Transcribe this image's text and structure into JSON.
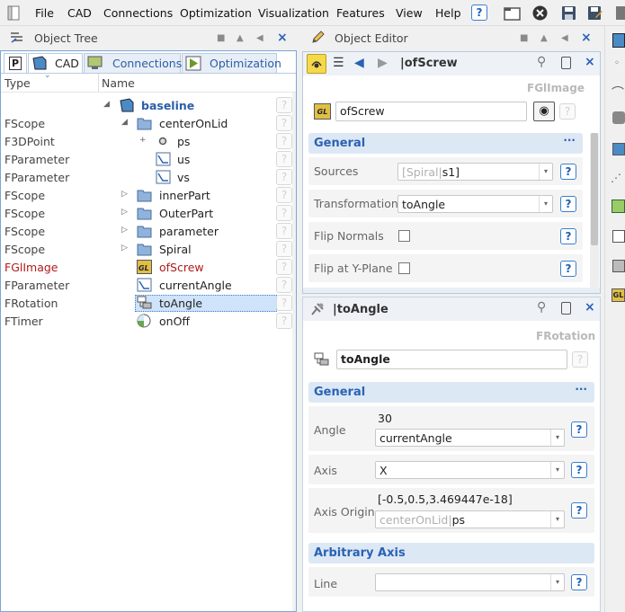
{
  "menubar": {
    "items": [
      "File",
      "CAD",
      "Connections",
      "Optimization",
      "Visualization",
      "Features",
      "View",
      "Help"
    ],
    "help_button": "?"
  },
  "object_tree": {
    "title": "Object Tree",
    "tabs": [
      {
        "label": "P"
      },
      {
        "label": "CAD"
      },
      {
        "label": "Connections"
      },
      {
        "label": "Optimization"
      }
    ],
    "columns": {
      "type": "Type",
      "name": "Name"
    },
    "root": "baseline",
    "rows": [
      {
        "type": "FScope",
        "name": "centerOnLid",
        "expander": "◢",
        "icon": "folder-icon"
      },
      {
        "type": "F3DPoint",
        "name": "ps",
        "expander": "+",
        "icon": "point-icon"
      },
      {
        "type": "FParameter",
        "name": "us",
        "icon": "parameter-icon"
      },
      {
        "type": "FParameter",
        "name": "vs",
        "icon": "parameter-icon"
      },
      {
        "type": "FScope",
        "name": "innerPart",
        "expander": "▷",
        "icon": "folder-icon"
      },
      {
        "type": "FScope",
        "name": "OuterPart",
        "expander": "▷",
        "icon": "folder-icon"
      },
      {
        "type": "FScope",
        "name": "parameter",
        "expander": "▷",
        "icon": "folder-icon"
      },
      {
        "type": "FScope",
        "name": "Spiral",
        "expander": "▷",
        "icon": "folder-icon"
      },
      {
        "type": "FGlImage",
        "name": "ofScrew",
        "icon": "gl-image-icon",
        "red": true
      },
      {
        "type": "FParameter",
        "name": "currentAngle",
        "icon": "parameter-icon"
      },
      {
        "type": "FRotation",
        "name": "toAngle",
        "icon": "rotation-icon",
        "selected": true
      },
      {
        "type": "FTimer",
        "name": "onOff",
        "icon": "timer-icon"
      }
    ]
  },
  "object_editor": {
    "title": "Object Editor",
    "editor1": {
      "header": "|ofScrew",
      "class_name": "FGlImage",
      "name_value": "ofScrew",
      "section": "General",
      "section_more": "···",
      "props": [
        {
          "label": "Sources",
          "value_gray": "[Spiral|",
          "value": "s1]"
        },
        {
          "label": "Transformation",
          "value": "toAngle"
        },
        {
          "label": "Flip Normals"
        },
        {
          "label": "Flip at Y-Plane"
        }
      ]
    },
    "editor2": {
      "header": "|toAngle",
      "class_name": "FRotation",
      "name_value": "toAngle",
      "section": "General",
      "section_more": "···",
      "angle_label": "Angle",
      "angle_value": "30",
      "angle_combo": "currentAngle",
      "axis_label": "Axis",
      "axis_combo": "X",
      "axis_origin_label": "Axis Origin",
      "axis_origin_value": "[-0.5,0.5,3.469447e-18]",
      "axis_origin_gray": "centerOnLid|",
      "axis_origin_combo": "ps",
      "section2": "Arbitrary Axis",
      "line_label": "Line",
      "line_combo": ""
    }
  },
  "colors": {
    "accent": "#2a62b5",
    "error_red": "#b11a1a",
    "section_bg": "#dde8f5",
    "selection": "#cfe3fa"
  }
}
